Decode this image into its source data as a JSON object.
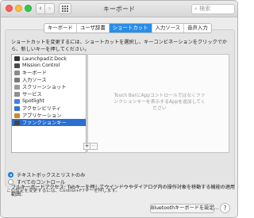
{
  "window": {
    "title": "キーボード",
    "search_placeholder": "検索",
    "nav_back_glyph": "‹",
    "nav_forward_glyph": "›"
  },
  "tabs": [
    {
      "label": "キーボード",
      "selected": false
    },
    {
      "label": "ユーザ辞書",
      "selected": false
    },
    {
      "label": "ショートカット",
      "selected": true
    },
    {
      "label": "入力ソース",
      "selected": false
    },
    {
      "label": "音声入力",
      "selected": false
    }
  ],
  "intro_text": "ショートカットを変更するには、ショートカットを選択し、キーコンビネーションをクリックでから、新しいキーを押してください。",
  "categories": [
    {
      "label": "LaunchpadとDock",
      "icon": "launchpad-icon",
      "color": "#333333",
      "selected": false
    },
    {
      "label": "Mission Control",
      "icon": "mission-control-icon",
      "color": "#4a4a4a",
      "selected": false
    },
    {
      "label": "キーボード",
      "icon": "keyboard-icon",
      "color": "#8a8a8a",
      "selected": false
    },
    {
      "label": "入力ソース",
      "icon": "input-sources-icon",
      "color": "#7a7a7a",
      "selected": false
    },
    {
      "label": "スクリーンショット",
      "icon": "screenshot-icon",
      "color": "#9a9a9a",
      "selected": false
    },
    {
      "label": "サービス",
      "icon": "services-gear-icon",
      "color": "#8f8f8f",
      "selected": false
    },
    {
      "label": "Spotlight",
      "icon": "spotlight-icon",
      "color": "#3f83e6",
      "selected": false
    },
    {
      "label": "アクセシビリティ",
      "icon": "accessibility-icon",
      "color": "#2e73d8",
      "selected": false
    },
    {
      "label": "アプリケーション",
      "icon": "app-shortcuts-icon",
      "color": "#c98a2f",
      "selected": false
    },
    {
      "label": "ファンクションキー",
      "icon": "function-keys-icon",
      "color": "#444444",
      "selected": true
    }
  ],
  "touchbar_message": "Touch BarにAppコントロールではなくファンクションキーを表示するAppを追加してください",
  "plus_label": "+",
  "minus_label": "−",
  "full_keyboard_access_label": "フルキーボードアクセス: Tabキーを押してウインドウやダイアログ内の操作対象を移動する機能の適用範囲:",
  "radio_options": [
    {
      "label": "テキストボックスとリストのみ",
      "checked": true
    },
    {
      "label": "すべてのコントロール",
      "checked": false
    }
  ],
  "ctrl_f7_note": "この設定を変更するには、Control+F7キーを押します。",
  "bluetooth_button": "Bluetoothキーボードを設定...",
  "help_label": "?"
}
